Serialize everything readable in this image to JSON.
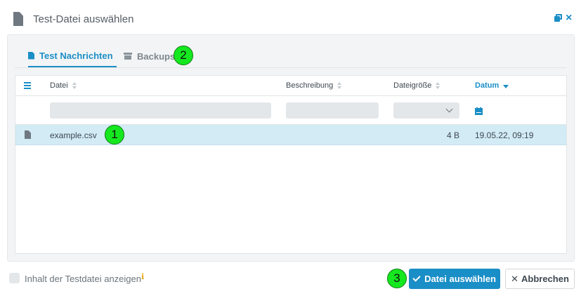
{
  "dialog": {
    "title": "Test-Datei auswählen"
  },
  "tabs": [
    {
      "label": "Test Nachrichten",
      "icon": "file-icon",
      "active": true
    },
    {
      "label": "Backups",
      "icon": "archive-icon",
      "active": false
    }
  ],
  "table": {
    "columns": [
      {
        "label": "Datei"
      },
      {
        "label": "Beschreibung"
      },
      {
        "label": "Dateigröße"
      },
      {
        "label": "Datum",
        "sorted": "desc"
      }
    ],
    "rows": [
      {
        "name": "example.csv",
        "description": "",
        "size": "4 B",
        "date": "19.05.22, 09:19",
        "selected": true
      }
    ]
  },
  "footer": {
    "checkbox_label": "Inhalt der Testdatei anzeigen",
    "checkbox_checked": false,
    "info_glyph": "ℹ",
    "primary_label": "Datei auswählen",
    "secondary_label": "Abbrechen",
    "secondary_icon": "✕"
  },
  "markers": [
    "1",
    "2",
    "3"
  ],
  "colors": {
    "accent": "#1a8ec6",
    "selected_row": "#d2ebf5",
    "marker": "#15e81f"
  }
}
